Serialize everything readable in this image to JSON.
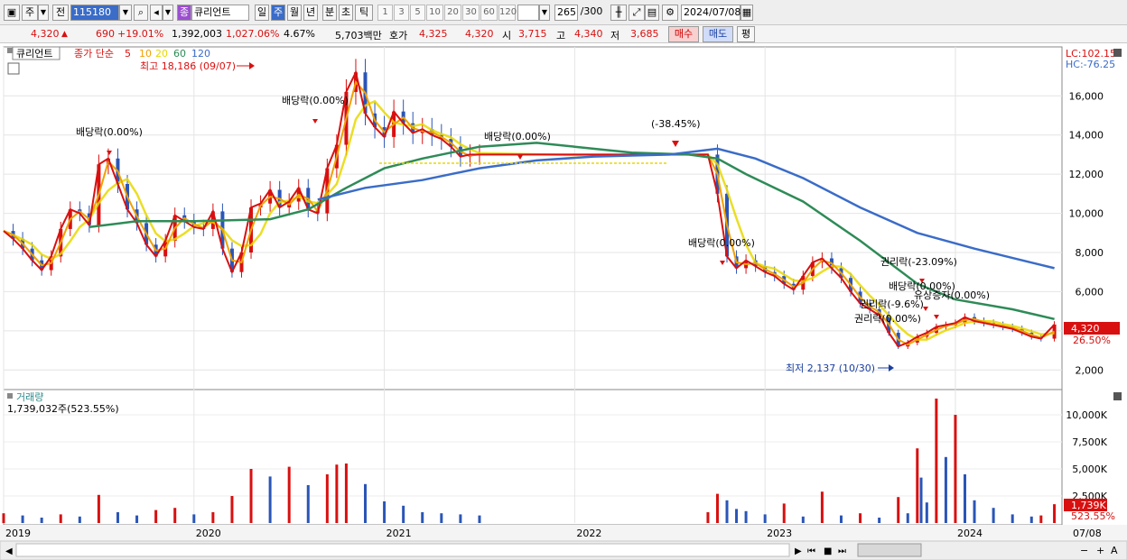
{
  "toolbar": {
    "period_main": "주",
    "prev_label": "전",
    "code": "115180",
    "stock_badge": "종",
    "stock_name": "큐리언트",
    "periods": [
      "일",
      "주",
      "월",
      "년",
      "분",
      "초",
      "틱"
    ],
    "active_period": "주",
    "intervals": [
      "1",
      "3",
      "5",
      "10",
      "20",
      "30",
      "60",
      "120"
    ],
    "count": "265",
    "count_total": "/300",
    "date": "2024/07/08"
  },
  "quote": {
    "price": "4,320",
    "change": "690",
    "change_pct": "+19.01%",
    "volume": "1,392,003",
    "vol_ratio": "1,027.06%",
    "turnover": "4.67%",
    "amount": "5,703백만",
    "bid_label": "호가",
    "bid1": "4,325",
    "bid2": "4,320",
    "open_label": "시",
    "open": "3,715",
    "high_label": "고",
    "high": "4,340",
    "low_label": "저",
    "low": "3,685",
    "buy_label": "매수",
    "sell_label": "매도",
    "avg_label": "평"
  },
  "legend": {
    "name": "큐리언트",
    "ma_label": "종가 단순",
    "ma": [
      {
        "period": "5",
        "color": "#d81010"
      },
      {
        "period": "10",
        "color": "#f0a000"
      },
      {
        "period": "20",
        "color": "#e8d800"
      },
      {
        "period": "60",
        "color": "#2e8b57"
      },
      {
        "period": "120",
        "color": "#3a6cc8"
      }
    ]
  },
  "right_info": {
    "lc": "LC:102.15",
    "hc": "HC:-76.25"
  },
  "annotations": {
    "high": "최고 18,186 (09/07)",
    "low": "최저 2,137 (10/30)",
    "div1": "배당락(0.00%)",
    "div2": "배당락(0.00%)",
    "div3": "배당락(0.00%)",
    "split": "(-38.45%)",
    "div4": "배당락(0.00%)",
    "rights1": "권리락(-23.09%)",
    "div5": "배당락(0.00%)",
    "cap": "유상증자(0.00%)",
    "rights2": "권리락(-9.6%)",
    "rights3": "권리락(0.00%)"
  },
  "price_tag": {
    "value": "4,320",
    "pct": "26.50%"
  },
  "volume_panel": {
    "title": "거래량",
    "value": "1,739,032주(523.55%)",
    "tag_value": "1,739K",
    "tag_pct": "523.55%"
  },
  "chart_data": {
    "type": "candlestick",
    "title": "",
    "price_axis": {
      "ticks": [
        2000,
        4000,
        6000,
        8000,
        10000,
        12000,
        14000,
        16000
      ],
      "labels": [
        "2,000",
        "4,000",
        "6,000",
        "8,000",
        "10,000",
        "12,000",
        "14,000",
        "16,000"
      ],
      "range": [
        1000,
        18500
      ]
    },
    "volume_axis": {
      "ticks": [
        2500,
        5000,
        7500,
        10000
      ],
      "labels": [
        "2,500K",
        "5,000K",
        "7,500K",
        "10,000K"
      ],
      "range": [
        0,
        12000
      ]
    },
    "x_labels": [
      "2019",
      "2020",
      "2021",
      "2022",
      "2023",
      "2024",
      "07/08"
    ],
    "series_close": [
      [
        2019.0,
        9100
      ],
      [
        2019.05,
        8700
      ],
      [
        2019.1,
        8200
      ],
      [
        2019.15,
        7600
      ],
      [
        2019.2,
        7100
      ],
      [
        2019.25,
        7800
      ],
      [
        2019.3,
        9200
      ],
      [
        2019.35,
        10200
      ],
      [
        2019.4,
        10000
      ],
      [
        2019.45,
        9400
      ],
      [
        2019.5,
        12500
      ],
      [
        2019.55,
        12800
      ],
      [
        2019.6,
        11500
      ],
      [
        2019.65,
        10200
      ],
      [
        2019.7,
        9500
      ],
      [
        2019.75,
        8400
      ],
      [
        2019.8,
        7800
      ],
      [
        2019.85,
        8600
      ],
      [
        2019.9,
        9900
      ],
      [
        2019.95,
        9600
      ],
      [
        2020.0,
        9300
      ],
      [
        2020.05,
        9200
      ],
      [
        2020.1,
        10100
      ],
      [
        2020.15,
        8200
      ],
      [
        2020.2,
        7000
      ],
      [
        2020.25,
        8000
      ],
      [
        2020.3,
        10300
      ],
      [
        2020.35,
        10500
      ],
      [
        2020.4,
        11200
      ],
      [
        2020.45,
        10300
      ],
      [
        2020.5,
        10600
      ],
      [
        2020.55,
        11300
      ],
      [
        2020.6,
        10200
      ],
      [
        2020.65,
        10000
      ],
      [
        2020.7,
        12300
      ],
      [
        2020.75,
        13500
      ],
      [
        2020.8,
        16200
      ],
      [
        2020.85,
        17200
      ],
      [
        2020.9,
        15100
      ],
      [
        2020.95,
        14400
      ],
      [
        2021.0,
        13900
      ],
      [
        2021.05,
        15200
      ],
      [
        2021.1,
        14600
      ],
      [
        2021.15,
        14100
      ],
      [
        2021.2,
        14300
      ],
      [
        2021.25,
        14000
      ],
      [
        2021.3,
        13800
      ],
      [
        2021.35,
        13400
      ],
      [
        2021.4,
        12900
      ],
      [
        2021.45,
        13000
      ],
      [
        2021.5,
        13000
      ],
      [
        2022.0,
        13000
      ],
      [
        2022.5,
        13000
      ],
      [
        2022.7,
        13000
      ],
      [
        2022.75,
        11000
      ],
      [
        2022.8,
        7800
      ],
      [
        2022.85,
        7200
      ],
      [
        2022.9,
        7600
      ],
      [
        2022.95,
        7300
      ],
      [
        2023.0,
        7000
      ],
      [
        2023.05,
        6800
      ],
      [
        2023.1,
        6400
      ],
      [
        2023.15,
        6100
      ],
      [
        2023.2,
        6800
      ],
      [
        2023.25,
        7500
      ],
      [
        2023.3,
        7700
      ],
      [
        2023.35,
        7200
      ],
      [
        2023.4,
        6700
      ],
      [
        2023.45,
        6000
      ],
      [
        2023.5,
        5400
      ],
      [
        2023.55,
        5100
      ],
      [
        2023.6,
        4800
      ],
      [
        2023.65,
        3900
      ],
      [
        2023.7,
        3200
      ],
      [
        2023.75,
        3400
      ],
      [
        2023.8,
        3700
      ],
      [
        2023.85,
        3900
      ],
      [
        2023.9,
        4200
      ],
      [
        2023.95,
        4300
      ],
      [
        2024.0,
        4400
      ],
      [
        2024.05,
        4700
      ],
      [
        2024.1,
        4500
      ],
      [
        2024.15,
        4400
      ],
      [
        2024.2,
        4300
      ],
      [
        2024.25,
        4200
      ],
      [
        2024.3,
        4100
      ],
      [
        2024.35,
        3900
      ],
      [
        2024.4,
        3700
      ],
      [
        2024.45,
        3600
      ],
      [
        2024.52,
        4320
      ]
    ],
    "ma60": [
      [
        2019.45,
        9300
      ],
      [
        2019.7,
        9600
      ],
      [
        2020.0,
        9600
      ],
      [
        2020.4,
        9700
      ],
      [
        2020.6,
        10200
      ],
      [
        2020.8,
        11300
      ],
      [
        2021.0,
        12300
      ],
      [
        2021.2,
        12800
      ],
      [
        2021.5,
        13400
      ],
      [
        2021.8,
        13600
      ],
      [
        2022.0,
        13400
      ],
      [
        2022.3,
        13100
      ],
      [
        2022.6,
        13000
      ],
      [
        2022.75,
        12800
      ],
      [
        2022.9,
        12000
      ],
      [
        2023.2,
        10600
      ],
      [
        2023.5,
        8600
      ],
      [
        2023.8,
        6400
      ],
      [
        2024.0,
        5600
      ],
      [
        2024.3,
        5100
      ],
      [
        2024.52,
        4600
      ]
    ],
    "ma120": [
      [
        2020.65,
        10700
      ],
      [
        2020.9,
        11300
      ],
      [
        2021.2,
        11700
      ],
      [
        2021.5,
        12300
      ],
      [
        2021.8,
        12700
      ],
      [
        2022.1,
        12900
      ],
      [
        2022.5,
        13000
      ],
      [
        2022.75,
        13300
      ],
      [
        2022.95,
        12800
      ],
      [
        2023.2,
        11800
      ],
      [
        2023.5,
        10300
      ],
      [
        2023.8,
        9000
      ],
      [
        2024.1,
        8200
      ],
      [
        2024.52,
        7200
      ]
    ],
    "volume": [
      [
        2019.0,
        900
      ],
      [
        2019.1,
        700
      ],
      [
        2019.2,
        500
      ],
      [
        2019.3,
        800
      ],
      [
        2019.4,
        600
      ],
      [
        2019.5,
        2600
      ],
      [
        2019.6,
        1000
      ],
      [
        2019.7,
        700
      ],
      [
        2019.8,
        1200
      ],
      [
        2019.9,
        1400
      ],
      [
        2020.0,
        800
      ],
      [
        2020.1,
        1000
      ],
      [
        2020.2,
        2500
      ],
      [
        2020.3,
        5000
      ],
      [
        2020.4,
        4300
      ],
      [
        2020.5,
        5200
      ],
      [
        2020.6,
        3500
      ],
      [
        2020.7,
        4500
      ],
      [
        2020.75,
        5400
      ],
      [
        2020.8,
        5500
      ],
      [
        2020.9,
        3600
      ],
      [
        2021.0,
        2000
      ],
      [
        2021.1,
        1600
      ],
      [
        2021.2,
        1000
      ],
      [
        2021.3,
        900
      ],
      [
        2021.4,
        800
      ],
      [
        2021.5,
        700
      ],
      [
        2022.7,
        1000
      ],
      [
        2022.75,
        2700
      ],
      [
        2022.8,
        2100
      ],
      [
        2022.85,
        1300
      ],
      [
        2022.9,
        1100
      ],
      [
        2023.0,
        800
      ],
      [
        2023.1,
        1800
      ],
      [
        2023.2,
        600
      ],
      [
        2023.3,
        2900
      ],
      [
        2023.4,
        700
      ],
      [
        2023.5,
        900
      ],
      [
        2023.6,
        500
      ],
      [
        2023.7,
        2400
      ],
      [
        2023.75,
        900
      ],
      [
        2023.8,
        6900
      ],
      [
        2023.82,
        4200
      ],
      [
        2023.85,
        1900
      ],
      [
        2023.9,
        11500
      ],
      [
        2023.95,
        6100
      ],
      [
        2024.0,
        10000
      ],
      [
        2024.05,
        4500
      ],
      [
        2024.1,
        2100
      ],
      [
        2024.2,
        1400
      ],
      [
        2024.3,
        800
      ],
      [
        2024.4,
        600
      ],
      [
        2024.45,
        700
      ],
      [
        2024.52,
        1739
      ]
    ]
  }
}
